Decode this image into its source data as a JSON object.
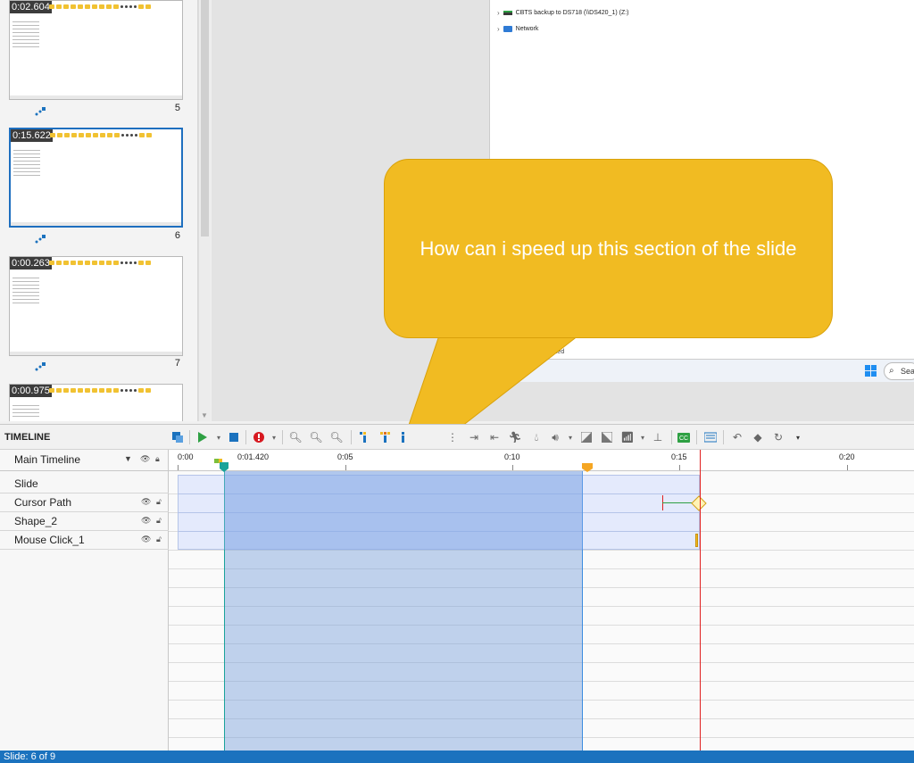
{
  "thumbnails": [
    {
      "duration": "0:02.604",
      "number": "5",
      "selected": false
    },
    {
      "duration": "0:15.622",
      "number": "6",
      "selected": true
    },
    {
      "duration": "0:00.263",
      "number": "7",
      "selected": false
    },
    {
      "duration": "0:00.975",
      "number": "",
      "selected": false
    }
  ],
  "explorer": {
    "drive_label": "CBTS backup to DS718 (\\\\DS420_1) (Z:)",
    "network_label": "Network",
    "status_fragment": "cted"
  },
  "taskbar": {
    "search_label": "Sea"
  },
  "callout": {
    "text": "How can i speed up this section of the slide"
  },
  "timeline": {
    "title": "TIMELINE",
    "main_label": "Main Timeline",
    "playhead_time": "0:01.420",
    "ruler_labels": [
      "0:00",
      "0:05",
      "0:10",
      "0:15",
      "0:20"
    ],
    "tracks": [
      "Slide",
      "Cursor Path",
      "Shape_2",
      "Mouse Click_1"
    ]
  },
  "status": {
    "text": "Slide: 6 of 9"
  },
  "colors": {
    "accent": "#1b72be",
    "callout": "#f1bb22",
    "selection": "#b8cdef",
    "end_marker": "#e02020",
    "playhead": "#1aa39a"
  }
}
